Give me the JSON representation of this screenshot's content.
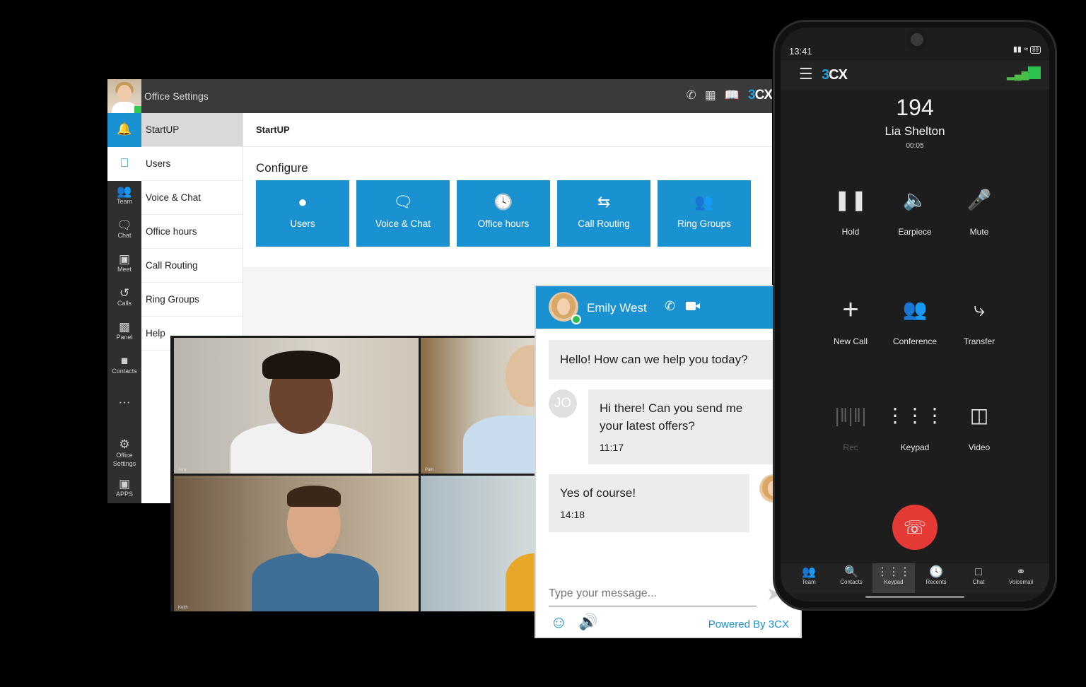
{
  "desktop": {
    "title": "Office Settings",
    "logo_prefix": "3",
    "logo_suffix": "CX",
    "rail": [
      {
        "label": "",
        "icon": "bell-icon"
      },
      {
        "label": "",
        "icon": "apple-icon"
      },
      {
        "label": "Team",
        "icon": "team-icon"
      },
      {
        "label": "Chat",
        "icon": "chat-icon"
      },
      {
        "label": "Meet",
        "icon": "meet-icon"
      },
      {
        "label": "Calls",
        "icon": "history-icon"
      },
      {
        "label": "Panel",
        "icon": "panel-icon"
      },
      {
        "label": "Contacts",
        "icon": "contacts-icon"
      },
      {
        "label": "···",
        "icon": "more-icon"
      },
      {
        "label": "Office Settings",
        "icon": "gear-icon"
      },
      {
        "label": "APPS",
        "icon": "apps-icon"
      }
    ],
    "submenu": [
      "StartUP",
      "Users",
      "Voice & Chat",
      "Office hours",
      "Call Routing",
      "Ring Groups",
      "Help"
    ],
    "header": "StartUP",
    "configure_label": "Configure",
    "config_buttons": [
      {
        "label": "Users",
        "icon": "user-icon"
      },
      {
        "label": "Voice & Chat",
        "icon": "speech-bubble-icon"
      },
      {
        "label": "Office hours",
        "icon": "clock-icon"
      },
      {
        "label": "Call Routing",
        "icon": "arrows-icon"
      },
      {
        "label": "Ring Groups",
        "icon": "group-icon"
      }
    ]
  },
  "video": {
    "captions": [
      "Amy",
      "Pam",
      "Keith",
      ""
    ]
  },
  "chat": {
    "agent_name": "Emily West",
    "messages": [
      {
        "from": "agent",
        "text": "Hello! How can we help you today?"
      },
      {
        "from": "visitor",
        "initials": "JO",
        "line1": "Hi there! Can you send me",
        "line2": "your latest offers?",
        "time": "11:17"
      },
      {
        "from": "agent",
        "text": "Yes of course!",
        "time": "14:18"
      }
    ],
    "input_placeholder": "Type your message...",
    "powered_by": "Powered By 3CX"
  },
  "phone": {
    "time": "13:41",
    "battery": "89",
    "logo_prefix": "3",
    "logo_suffix": "CX",
    "number": "194",
    "name": "Lia Shelton",
    "duration": "00:05",
    "buttons": [
      {
        "label": "Hold",
        "icon": "pause-icon"
      },
      {
        "label": "Earpiece",
        "icon": "speaker-icon"
      },
      {
        "label": "Mute",
        "icon": "microphone-icon"
      },
      {
        "label": "New Call",
        "icon": "plus-icon"
      },
      {
        "label": "Conference",
        "icon": "conference-icon"
      },
      {
        "label": "Transfer",
        "icon": "transfer-icon"
      },
      {
        "label": "Rec",
        "icon": "waveform-icon"
      },
      {
        "label": "Keypad",
        "icon": "keypad-icon"
      },
      {
        "label": "Video",
        "icon": "video-icon"
      }
    ],
    "nav": [
      {
        "label": "Team",
        "icon": "team-icon"
      },
      {
        "label": "Contacts",
        "icon": "contacts-icon"
      },
      {
        "label": "Keypad",
        "icon": "keypad-icon"
      },
      {
        "label": "Recents",
        "icon": "clock-icon"
      },
      {
        "label": "Chat",
        "icon": "chat-icon"
      },
      {
        "label": "Voicemail",
        "icon": "voicemail-icon"
      }
    ]
  },
  "colors": {
    "brand_blue": "#1a91d1",
    "hangup_red": "#e53935",
    "online_green": "#2ec04f"
  }
}
